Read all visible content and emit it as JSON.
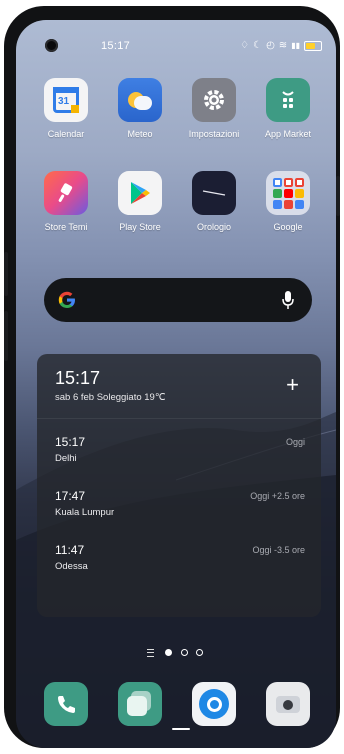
{
  "status": {
    "time": "15:17",
    "icons": [
      "alarm-icon",
      "moon-icon",
      "clock-icon",
      "wifi-icon",
      "signal-icon",
      "battery-icon"
    ]
  },
  "apps": [
    {
      "label": "Calendar",
      "icon": "calendar-icon",
      "badge": "31"
    },
    {
      "label": "Meteo",
      "icon": "weather-icon"
    },
    {
      "label": "Impostazioni",
      "icon": "settings-icon"
    },
    {
      "label": "App Market",
      "icon": "app-market-icon"
    },
    {
      "label": "Store Temi",
      "icon": "theme-store-icon"
    },
    {
      "label": "Play Store",
      "icon": "play-store-icon"
    },
    {
      "label": "Orologio",
      "icon": "clock-app-icon"
    },
    {
      "label": "Google",
      "icon": "google-folder-icon"
    }
  ],
  "search": {
    "logo": "google-g-icon",
    "mic": "mic-icon"
  },
  "widget": {
    "time": "15:17",
    "subtitle": "sab 6 feb  Soleggiato 19℃",
    "add": "+",
    "cities": [
      {
        "time": "15:17",
        "name": "Delhi",
        "offset": "Oggi"
      },
      {
        "time": "17:47",
        "name": "Kuala Lumpur",
        "offset": "Oggi +2.5 ore"
      },
      {
        "time": "11:47",
        "name": "Odessa",
        "offset": "Oggi -3.5 ore"
      }
    ]
  },
  "pager": {
    "pages": 3,
    "current": 0
  },
  "dock": [
    {
      "icon": "phone-icon"
    },
    {
      "icon": "recents-icon"
    },
    {
      "icon": "browser-icon"
    },
    {
      "icon": "camera-icon"
    }
  ],
  "colors": {
    "accent_green": "#3e9b84",
    "battery": "#ffd02a"
  }
}
